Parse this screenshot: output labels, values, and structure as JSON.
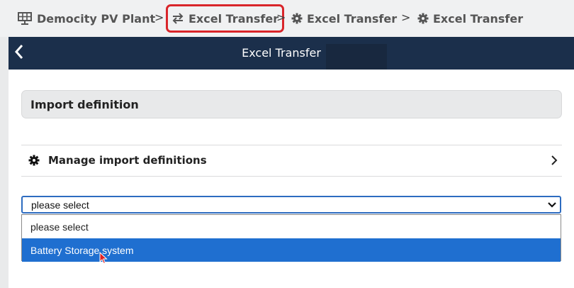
{
  "breadcrumb": {
    "items": [
      {
        "label": "Democity PV Plant",
        "icon": "solar-panel-icon"
      },
      {
        "label": "Excel Transfer",
        "icon": "transfer-arrows-icon",
        "highlighted": true
      },
      {
        "label": "Excel Transfer",
        "icon": "gear-icon"
      },
      {
        "label": "Excel Transfer",
        "icon": "gear-icon"
      }
    ],
    "separator": ">"
  },
  "header": {
    "title": "Excel Transfer",
    "back_icon": "chevron-left-icon",
    "background": "#1b2f4b"
  },
  "section": {
    "title": "Import definition"
  },
  "manage": {
    "label": "Manage import definitions",
    "icon": "gear-icon",
    "chevron": "chevron-right-icon"
  },
  "select": {
    "value": "please select",
    "options": [
      "please select",
      "Battery Storage system"
    ],
    "highlighted_option": "Battery Storage system"
  },
  "colors": {
    "accent": "#1f6fd0",
    "highlight_border": "#d9252a"
  }
}
